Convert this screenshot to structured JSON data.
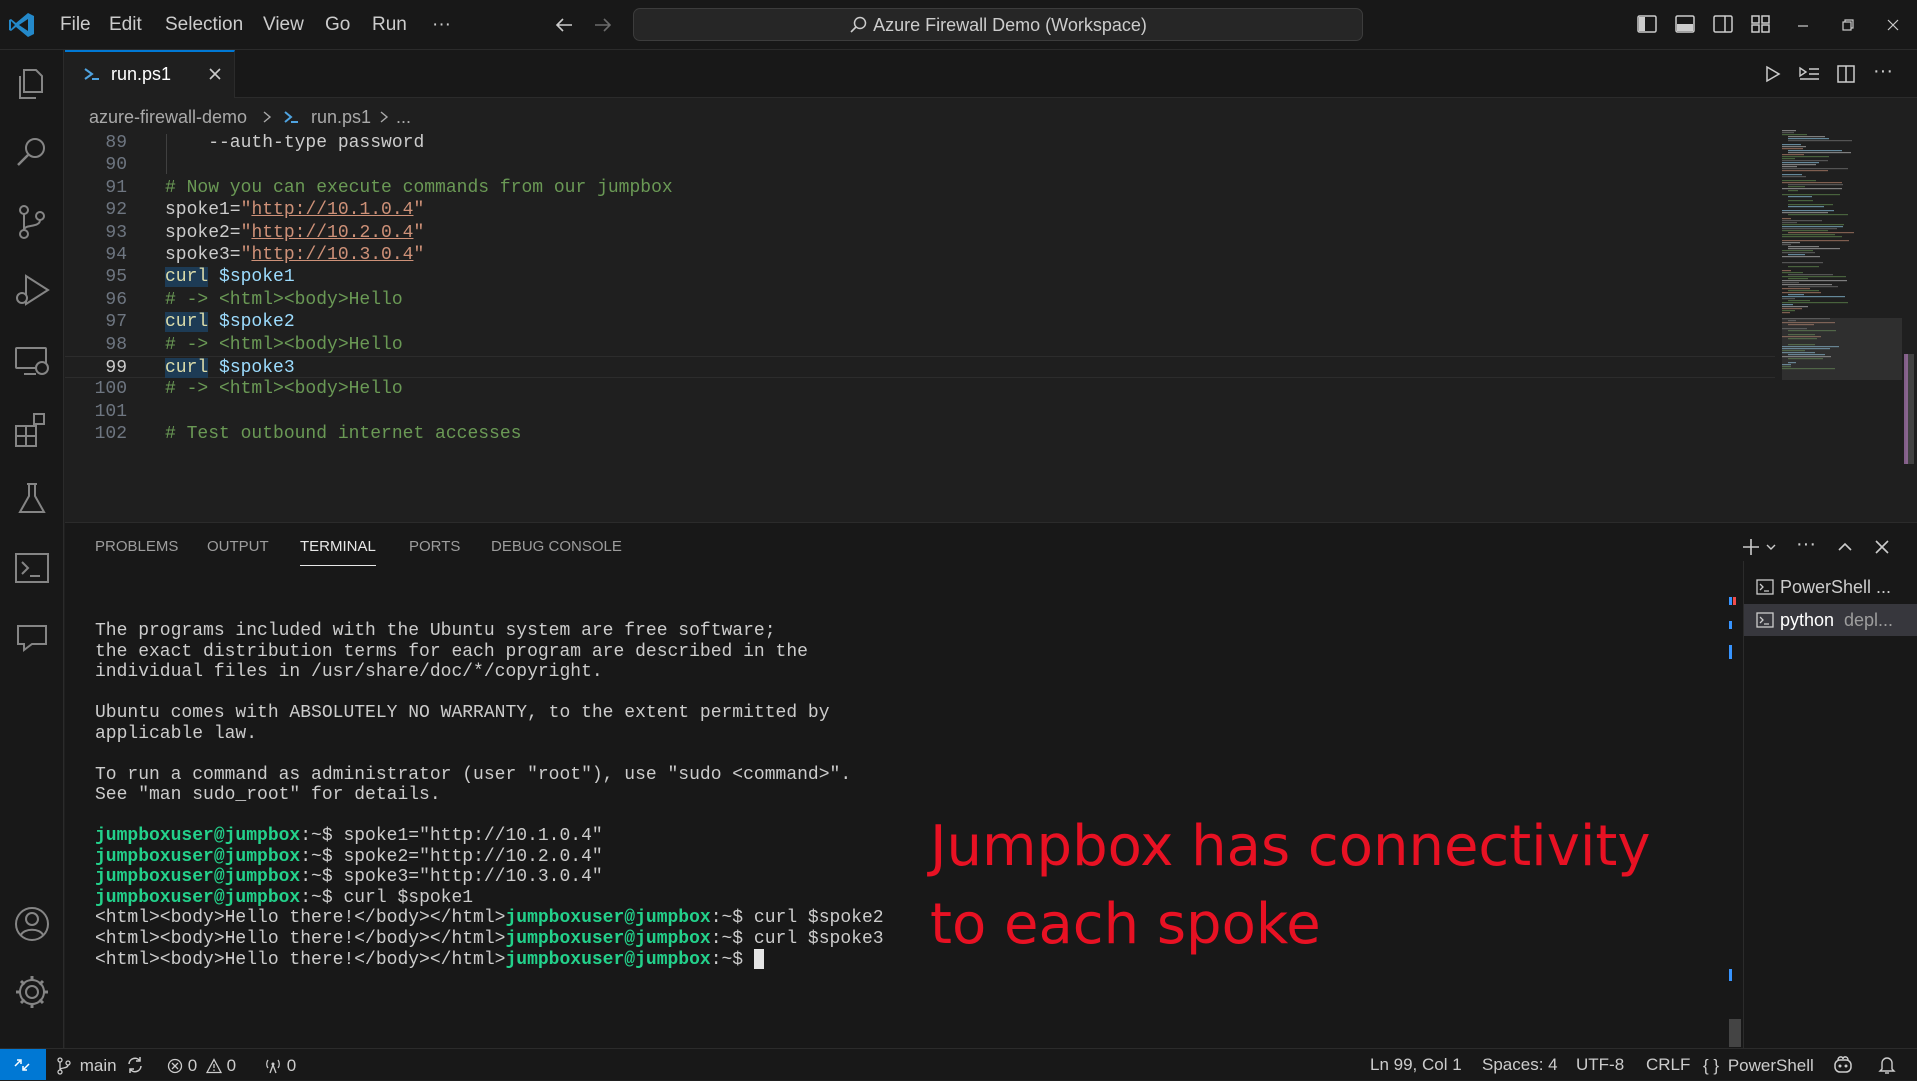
{
  "titlebar": {
    "menu": [
      "File",
      "Edit",
      "Selection",
      "View",
      "Go",
      "Run"
    ],
    "more": "···",
    "search": "Azure Firewall Demo (Workspace)"
  },
  "tab": {
    "label": "run.ps1"
  },
  "breadcrumb": {
    "folder": "azure-firewall-demo",
    "file": "run.ps1",
    "ellipsis": "..."
  },
  "editor": {
    "current_line": 99,
    "lines": [
      {
        "n": "89",
        "text": "    --auth-type password"
      },
      {
        "n": "90",
        "text": ""
      },
      {
        "n": "91",
        "comment": "# Now you can execute commands from our jumpbox"
      },
      {
        "n": "92",
        "name": "spoke1=",
        "q1": "\"",
        "url": "http://10.1.0.4",
        "q2": "\""
      },
      {
        "n": "93",
        "name": "spoke2=",
        "q1": "\"",
        "url": "http://10.2.0.4",
        "q2": "\""
      },
      {
        "n": "94",
        "name": "spoke3=",
        "q1": "\"",
        "url": "http://10.3.0.4",
        "q2": "\""
      },
      {
        "n": "95",
        "cmd": "curl",
        "var": "$spoke1"
      },
      {
        "n": "96",
        "comment": "# -> <html><body>Hello"
      },
      {
        "n": "97",
        "cmd": "curl",
        "var": "$spoke2"
      },
      {
        "n": "98",
        "comment": "# -> <html><body>Hello"
      },
      {
        "n": "99",
        "cmd": "curl",
        "var": "$spoke3"
      },
      {
        "n": "100",
        "comment": "# -> <html><body>Hello"
      },
      {
        "n": "101",
        "text": ""
      },
      {
        "n": "102",
        "comment": "# Test outbound internet accesses"
      }
    ]
  },
  "panel": {
    "tabs": [
      "PROBLEMS",
      "OUTPUT",
      "TERMINAL",
      "PORTS",
      "DEBUG CONSOLE"
    ],
    "active_tab": "TERMINAL",
    "terminals": [
      {
        "name": "PowerShell ...",
        "desc": ""
      },
      {
        "name": "python",
        "desc": "depl..."
      }
    ],
    "terminal_lines": [
      {
        "text": "The programs included with the Ubuntu system are free software;"
      },
      {
        "text": "the exact distribution terms for each program are described in the"
      },
      {
        "text": "individual files in /usr/share/doc/*/copyright."
      },
      {
        "text": ""
      },
      {
        "text": "Ubuntu comes with ABSOLUTELY NO WARRANTY, to the extent permitted by"
      },
      {
        "text": "applicable law."
      },
      {
        "text": ""
      },
      {
        "text": "To run a command as administrator (user \"root\"), use \"sudo <command>\"."
      },
      {
        "text": "See \"man sudo_root\" for details."
      },
      {
        "text": ""
      },
      {
        "pre": "",
        "prompt": "jumpboxuser@jumpbox",
        "path": ":~$ ",
        "cmd": "spoke1=\"http://10.1.0.4\""
      },
      {
        "pre": "",
        "prompt": "jumpboxuser@jumpbox",
        "path": ":~$ ",
        "cmd": "spoke2=\"http://10.2.0.4\""
      },
      {
        "pre": "",
        "prompt": "jumpboxuser@jumpbox",
        "path": ":~$ ",
        "cmd": "spoke3=\"http://10.3.0.4\""
      },
      {
        "pre": "",
        "prompt": "jumpboxuser@jumpbox",
        "path": ":~$ ",
        "cmd": "curl $spoke1"
      },
      {
        "pre": "<html><body>Hello there!</body></html>",
        "prompt": "jumpboxuser@jumpbox",
        "path": ":~$ ",
        "cmd": "curl $spoke2"
      },
      {
        "pre": "<html><body>Hello there!</body></html>",
        "prompt": "jumpboxuser@jumpbox",
        "path": ":~$ ",
        "cmd": "curl $spoke3"
      },
      {
        "pre": "<html><body>Hello there!</body></html>",
        "prompt": "jumpboxuser@jumpbox",
        "path": ":~$ ",
        "cmd": "",
        "cursor": true
      }
    ]
  },
  "annotation": {
    "line1": "Jumpbox has connectivity",
    "line2": "to each spoke"
  },
  "statusbar": {
    "branch": "main",
    "errors": "0",
    "warnings": "0",
    "ports": "0",
    "position": "Ln 99, Col 1",
    "spaces": "Spaces: 4",
    "encoding": "UTF-8",
    "eol": "CRLF",
    "language": "PowerShell"
  },
  "colors": {
    "accent": "#0078d4",
    "prompt_green": "#23d18b",
    "annotation_red": "#e81123",
    "comment_green": "#6a9955",
    "string": "#ce9178"
  }
}
